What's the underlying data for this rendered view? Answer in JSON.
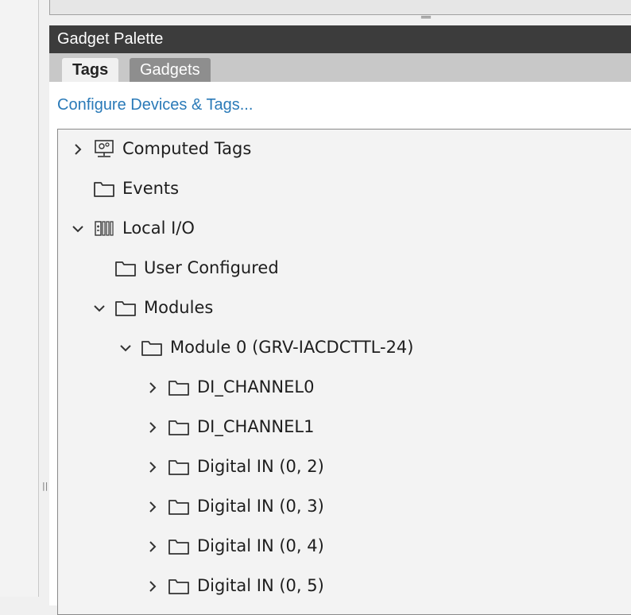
{
  "panel": {
    "title": "Gadget Palette",
    "tabs": [
      {
        "label": "Tags",
        "active": true
      },
      {
        "label": "Gadgets",
        "active": false
      }
    ],
    "configure_link": "Configure Devices & Tags..."
  },
  "tree": [
    {
      "label": "Computed Tags",
      "expanded": false,
      "icon": "computed-tags-icon"
    },
    {
      "label": "Events",
      "expanded": null,
      "icon": "folder-icon"
    },
    {
      "label": "Local I/O",
      "expanded": true,
      "icon": "io-rack-icon"
    },
    {
      "label": "User Configured",
      "expanded": null,
      "icon": "folder-icon"
    },
    {
      "label": "Modules",
      "expanded": true,
      "icon": "folder-icon"
    },
    {
      "label": "Module 0 (GRV-IACDCTTL-24)",
      "expanded": true,
      "icon": "folder-icon"
    },
    {
      "label": "DI_CHANNEL0",
      "expanded": false,
      "icon": "folder-icon"
    },
    {
      "label": "DI_CHANNEL1",
      "expanded": false,
      "icon": "folder-icon"
    },
    {
      "label": "Digital IN (0, 2)",
      "expanded": false,
      "icon": "folder-icon"
    },
    {
      "label": "Digital IN (0, 3)",
      "expanded": false,
      "icon": "folder-icon"
    },
    {
      "label": "Digital IN (0, 4)",
      "expanded": false,
      "icon": "folder-icon"
    },
    {
      "label": "Digital IN (0, 5)",
      "expanded": false,
      "icon": "folder-icon"
    }
  ]
}
